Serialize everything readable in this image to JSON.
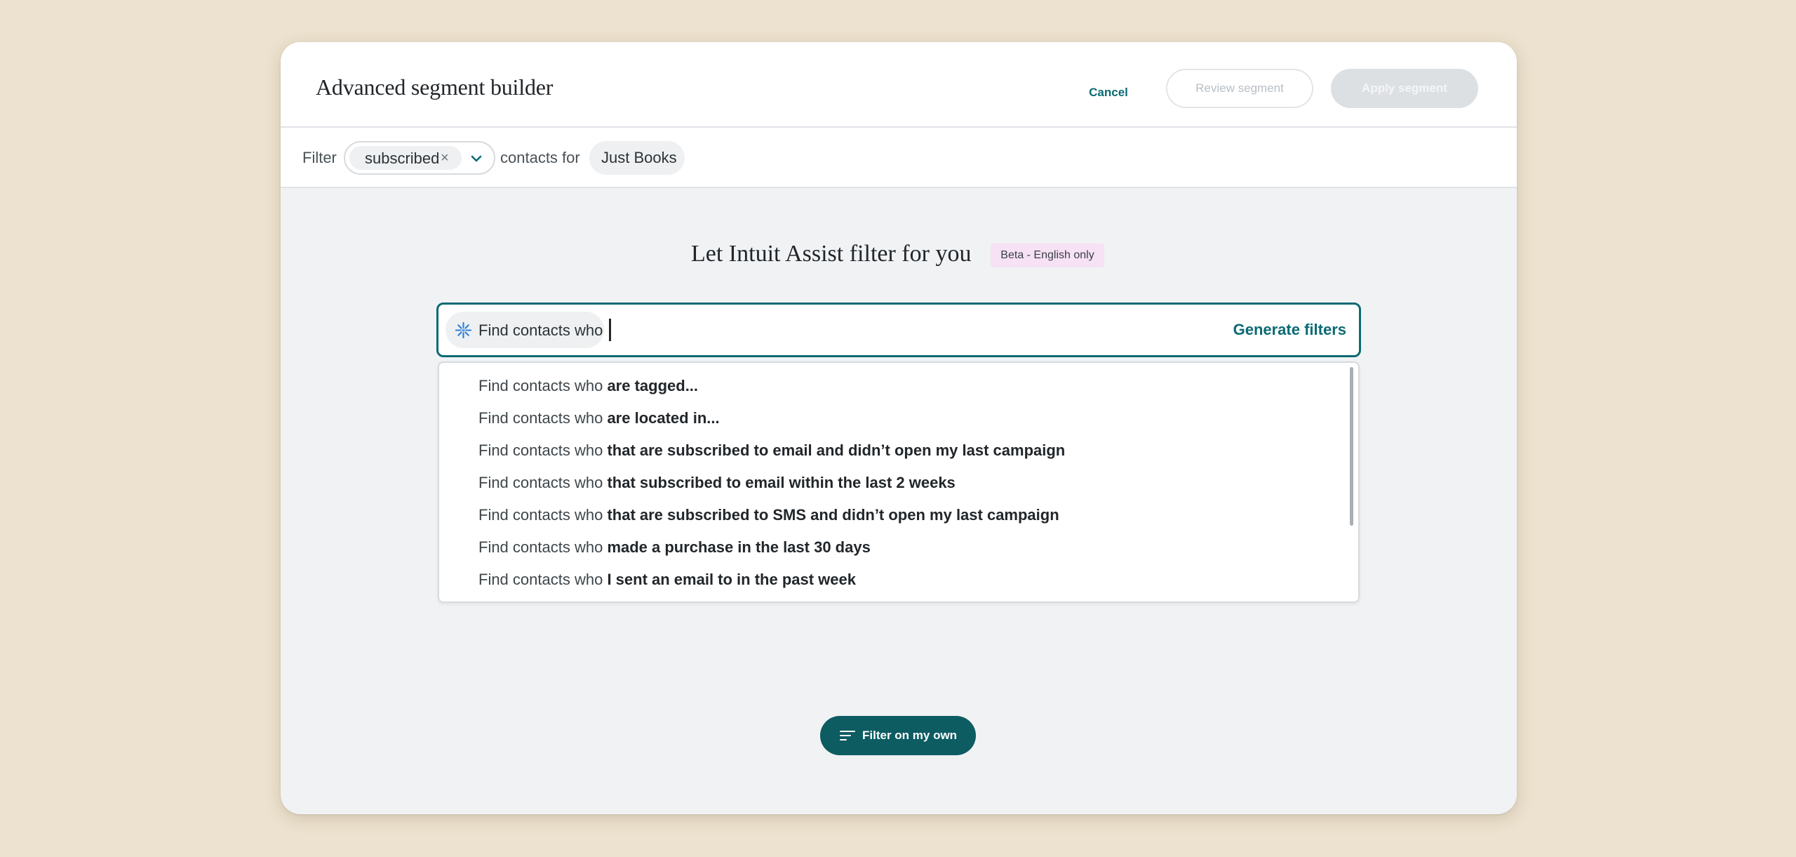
{
  "header": {
    "title": "Advanced segment builder",
    "cancel_label": "Cancel",
    "review_label": "Review segment",
    "apply_label": "Apply segment"
  },
  "filter_bar": {
    "prefix": "Filter",
    "status_value": "subscribed",
    "remove_symbol": "×",
    "middle": "contacts for",
    "brand": "Just Books"
  },
  "assist": {
    "title": "Let Intuit Assist filter for you",
    "badge": "Beta - English only",
    "prefix": "Find contacts who",
    "generate_label": "Generate filters",
    "suggestions": [
      {
        "prefix": "Find contacts who",
        "completion": "are tagged..."
      },
      {
        "prefix": "Find contacts who",
        "completion": "are located in..."
      },
      {
        "prefix": "Find contacts who",
        "completion": "that are subscribed to email and didn’t open my last campaign"
      },
      {
        "prefix": "Find contacts who",
        "completion": "that subscribed to email within the last 2 weeks"
      },
      {
        "prefix": "Find contacts who",
        "completion": "that are subscribed to SMS and didn’t open my last campaign"
      },
      {
        "prefix": "Find contacts who",
        "completion": "made a purchase in the last 30 days"
      },
      {
        "prefix": "Find contacts who",
        "completion": "I sent an email to in the past week"
      }
    ]
  },
  "footer": {
    "own_label": "Filter on my own"
  },
  "colors": {
    "accent": "#0b6a72",
    "primary_button": "#0c5c62",
    "page_bg": "#ede2cf",
    "badge_bg": "#f7e1f5"
  },
  "icons": [
    "chevron-down-icon",
    "sparkle-icon",
    "filter-lines-icon",
    "close-icon"
  ]
}
